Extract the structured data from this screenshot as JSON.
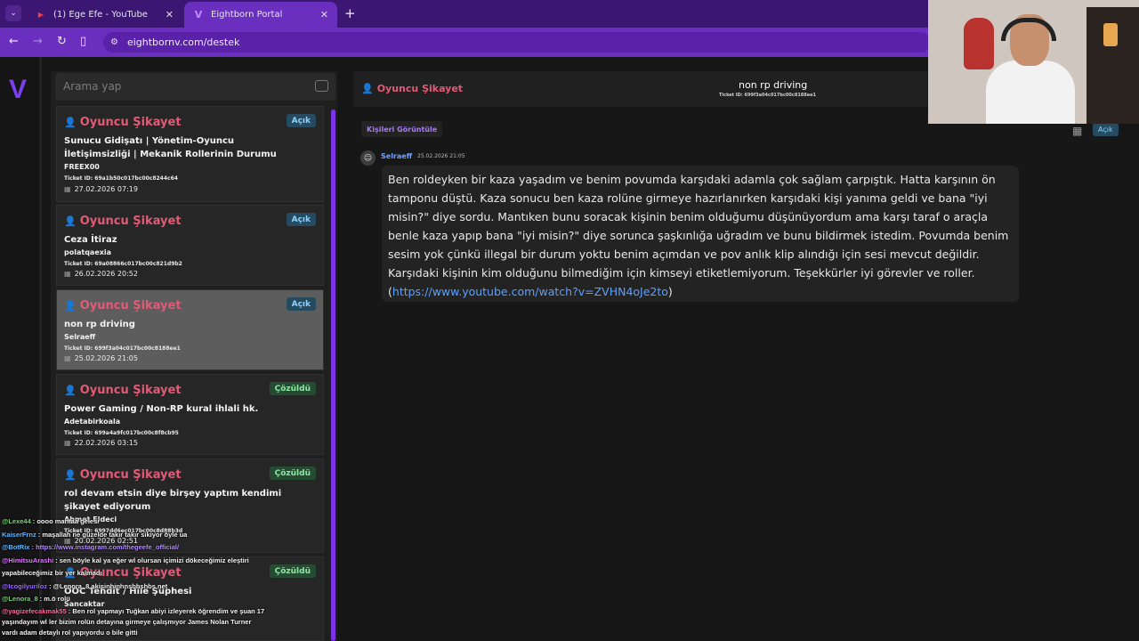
{
  "browser": {
    "tabs": [
      {
        "title": "(1) Ege Efe - YouTube"
      },
      {
        "title": "Eightborn Portal"
      }
    ],
    "url": "eightbornv.com/destek"
  },
  "sidebar": {
    "logo": "V"
  },
  "search": {
    "placeholder": "Arama yap"
  },
  "tickets": [
    {
      "category": "Oyuncu Şikayet",
      "status": "Açık",
      "title": "Sunucu Gidişatı | Yönetim-Oyuncu İletişimsizliği | Mekanik Rollerinin Durumu",
      "author": "FREEX00",
      "ticket_id": "Ticket ID: 69a1b50c017bc00c8244c64",
      "date": "27.02.2026 07:19"
    },
    {
      "category": "Oyuncu Şikayet",
      "status": "Açık",
      "title": "Ceza İtiraz",
      "author": "polatqaexia",
      "ticket_id": "Ticket ID: 69a08866c017bc00c821d9b2",
      "date": "26.02.2026 20:52"
    },
    {
      "category": "Oyuncu Şikayet",
      "status": "Açık",
      "title": "non rp driving",
      "author": "Selraeff",
      "ticket_id": "Ticket ID: 699f3a04c017bc00c8188ee1",
      "date": "25.02.2026 21:05"
    },
    {
      "category": "Oyuncu Şikayet",
      "status": "Çözüldü",
      "title": "Power Gaming / Non-RP kural ihlali hk.",
      "author": "Adetabirkoala",
      "ticket_id": "Ticket ID: 699a4a9fc017bc00c8f8cb95",
      "date": "22.02.2026 03:15"
    },
    {
      "category": "Oyuncu Şikayet",
      "status": "Çözüldü",
      "title": "rol devam etsin diye birşey yaptım kendimi şikayet ediyorum",
      "author": "Ahmet Eldeci",
      "ticket_id": "Ticket ID: 6997dd6ec017bc00c8d88b3d",
      "date": "20.02.2026 02:51"
    },
    {
      "category": "Oyuncu Şikayet",
      "status": "Çözüldü",
      "title": "OOC Tehdit / Hile Şüphesi",
      "author": "Sancaktar",
      "ticket_id": "",
      "date": ""
    }
  ],
  "detail": {
    "category": "Oyuncu Şikayet",
    "title": "non rp driving",
    "ticket_id": "Ticket ID: 699f3a04c017bc00c8188ee1",
    "people_button": "Kişileri Görüntüle",
    "status": "Açık",
    "message": {
      "sender": "Selraeff",
      "date": "25.02.2026 21:05",
      "text": "Ben roldeyken bir kaza yaşadım ve benim povumda karşıdaki adamla çok sağlam çarpıştık. Hatta karşının ön tamponu düştü. Kaza sonucu ben kaza rolüne girmeye hazırlanırken karşıdaki kişi yanıma geldi ve bana \"iyi misin?\" diye sordu. Mantıken bunu soracak kişinin benim olduğumu düşünüyordum ama karşı taraf o araçla benle kaza yapıp bana \"iyi misin?\" diye sorunca şaşkınlığa uğradım ve bunu bildirmek istedim. Povumda benim sesim yok çünkü illegal bir durum yoktu benim açımdan ve pov anlık klip alındığı için sesi mevcut değildir. Karşıdaki kişinin kim olduğunu bilmediğim için kimseyi etiketlemiyorum. Teşekkürler iyi görevler ve roller.",
      "link_open": "(",
      "link": "https://www.youtube.com/watch?v=ZVHN4oJe2to",
      "link_close": ")"
    }
  },
  "stream_chat": [
    {
      "user": "@Lexe44",
      "text": ": oooo mantaa gelesi",
      "color": "#7ad47a"
    },
    {
      "user": "KaiserFrnz",
      "text": ": maşallah ne güzelde takır takır sikiyor öyle ua",
      "color": "#61b8ff"
    },
    {
      "user": "@BotRix",
      "text": ": https://www.instagram.com/thegeefe_official/",
      "color": "#61b8ff"
    },
    {
      "user": "@HimitsuArashi",
      "text": ": sen böyle kal ya eğer wl olursan içimizi dökeceğimiz eleştiri yapabileceğimiz bir yer kalmadı",
      "color": "#e07aff"
    },
    {
      "user": "@Icogilyuriloz",
      "text": ": @Lenora_8 akisinhinhnsbhshbs net",
      "color": "#9a6bff"
    },
    {
      "user": "@Lenora_8",
      "text": ": m.ö rolü",
      "color": "#7ad47a"
    },
    {
      "user": "@yagizefecakmak55",
      "text": ": Ben rol yapmayı Tuğkan abiyi izleyerek öğrendim ve şuan 17 yaşındayım wl ler bizim rolün detayına girmeye çalışmıyor James Nolan Turner vardı adam detaylı rol yapıyordu o bile gitti",
      "color": "#ff6b9b"
    }
  ]
}
